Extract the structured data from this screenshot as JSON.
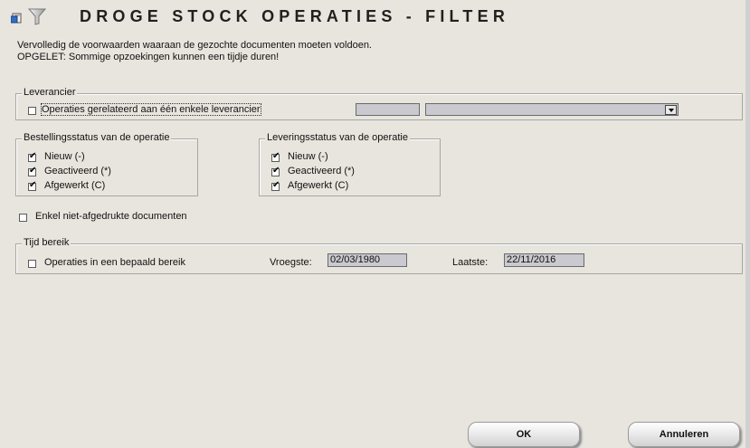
{
  "title": "DROGE STOCK OPERATIES - FILTER",
  "intro": {
    "line1": "Vervolledig de voorwaarden waaraan de gezochte documenten moeten voldoen.",
    "line2": "OPGELET: Sommige opzoekingen kunnen een tijdje duren!"
  },
  "supplier": {
    "legend": "Leverancier",
    "checkbox_label": "Operaties gerelateerd aan één enkele leverancier",
    "checked": false,
    "code_value": "",
    "select_value": ""
  },
  "order_status": {
    "legend": "Bestellingsstatus van de operatie",
    "items": [
      {
        "label": "Nieuw (-)",
        "checked": true
      },
      {
        "label": "Geactiveerd (*)",
        "checked": true
      },
      {
        "label": "Afgewerkt (C)",
        "checked": true
      }
    ]
  },
  "delivery_status": {
    "legend": "Leveringsstatus van de operatie",
    "items": [
      {
        "label": "Nieuw (-)",
        "checked": true
      },
      {
        "label": "Geactiveerd (*)",
        "checked": true
      },
      {
        "label": "Afgewerkt (C)",
        "checked": true
      }
    ]
  },
  "unprinted": {
    "label": "Enkel niet-afgedrukte documenten",
    "checked": false
  },
  "time_range": {
    "legend": "Tijd bereik",
    "checkbox_label": "Operaties in een bepaald bereik",
    "checked": false,
    "earliest_label": "Vroegste:",
    "earliest_value": "02/03/1980",
    "latest_label": "Laatste:",
    "latest_value": "22/11/2016"
  },
  "buttons": {
    "ok": "OK",
    "cancel": "Annuleren"
  },
  "icons": {
    "doc": "document-icon",
    "filter": "filter-funnel-icon"
  }
}
